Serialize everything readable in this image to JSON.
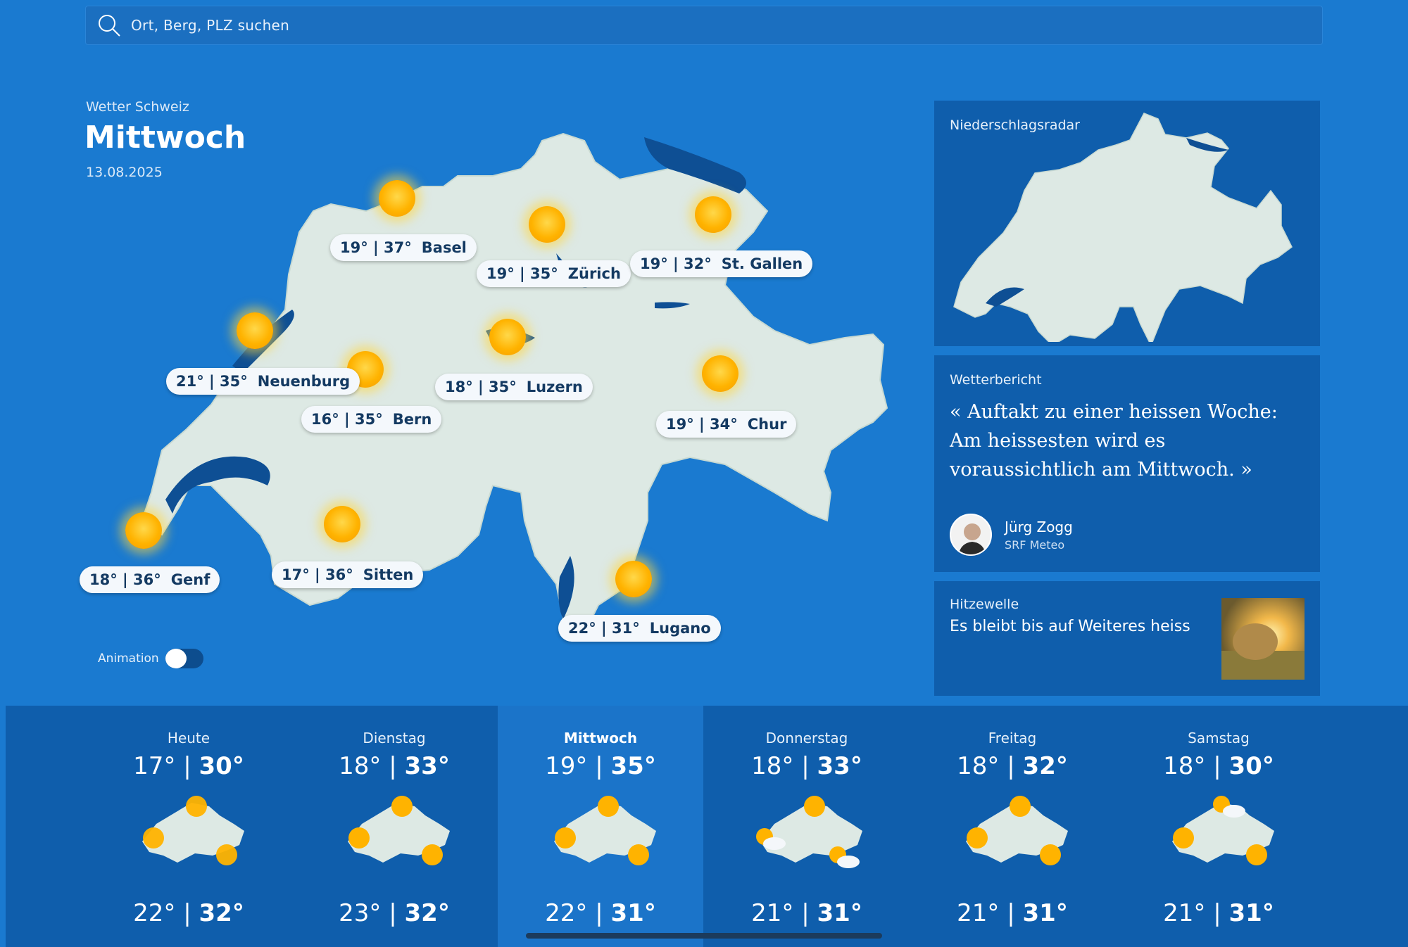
{
  "search": {
    "placeholder": "Ort, Berg, PLZ suchen"
  },
  "header": {
    "region": "Wetter Schweiz",
    "day": "Mittwoch",
    "date": "13.08.2025"
  },
  "map": {
    "cities": [
      {
        "min": "19°",
        "max": "37°",
        "name": "Basel"
      },
      {
        "min": "19°",
        "max": "35°",
        "name": "Zürich"
      },
      {
        "min": "19°",
        "max": "32°",
        "name": "St. Gallen"
      },
      {
        "min": "21°",
        "max": "35°",
        "name": "Neuenburg"
      },
      {
        "min": "18°",
        "max": "35°",
        "name": "Luzern"
      },
      {
        "min": "16°",
        "max": "35°",
        "name": "Bern"
      },
      {
        "min": "19°",
        "max": "34°",
        "name": "Chur"
      },
      {
        "min": "18°",
        "max": "36°",
        "name": "Genf"
      },
      {
        "min": "17°",
        "max": "36°",
        "name": "Sitten"
      },
      {
        "min": "22°",
        "max": "31°",
        "name": "Lugano"
      }
    ],
    "animation_label": "Animation",
    "animation_on": false
  },
  "radar": {
    "label": "Niederschlagsradar"
  },
  "report": {
    "label": "Wetterbericht",
    "quote": "« Auftakt zu einer heissen Woche: Am heissesten wird es voraussichtlich am Mittwoch. »",
    "author": "Jürg Zogg",
    "org": "SRF Meteo"
  },
  "heatwave": {
    "label": "Hitzewelle",
    "text": "Es bleibt bis auf Weiteres heiss"
  },
  "forecast": [
    {
      "day": "Heute",
      "north_min": "17°",
      "north_max": "30°",
      "south_min": "22°",
      "south_max": "32°",
      "icon": "sun"
    },
    {
      "day": "Dienstag",
      "north_min": "18°",
      "north_max": "33°",
      "south_min": "23°",
      "south_max": "32°",
      "icon": "sun"
    },
    {
      "day": "Mittwoch",
      "north_min": "19°",
      "north_max": "35°",
      "south_min": "22°",
      "south_max": "31°",
      "icon": "sun",
      "active": true
    },
    {
      "day": "Donnerstag",
      "north_min": "18°",
      "north_max": "33°",
      "south_min": "21°",
      "south_max": "31°",
      "icon": "sun-cloud"
    },
    {
      "day": "Freitag",
      "north_min": "18°",
      "north_max": "32°",
      "south_min": "21°",
      "south_max": "31°",
      "icon": "sun"
    },
    {
      "day": "Samstag",
      "north_min": "18°",
      "north_max": "30°",
      "south_min": "21°",
      "south_max": "31°",
      "icon": "sun-cloud"
    }
  ],
  "colors": {
    "background": "#1a7ad0",
    "panel": "#0f5eac",
    "active_day": "#1b74c9",
    "land": "#dde9e4",
    "lake": "#0e4f94",
    "sun": "#ffb300"
  }
}
